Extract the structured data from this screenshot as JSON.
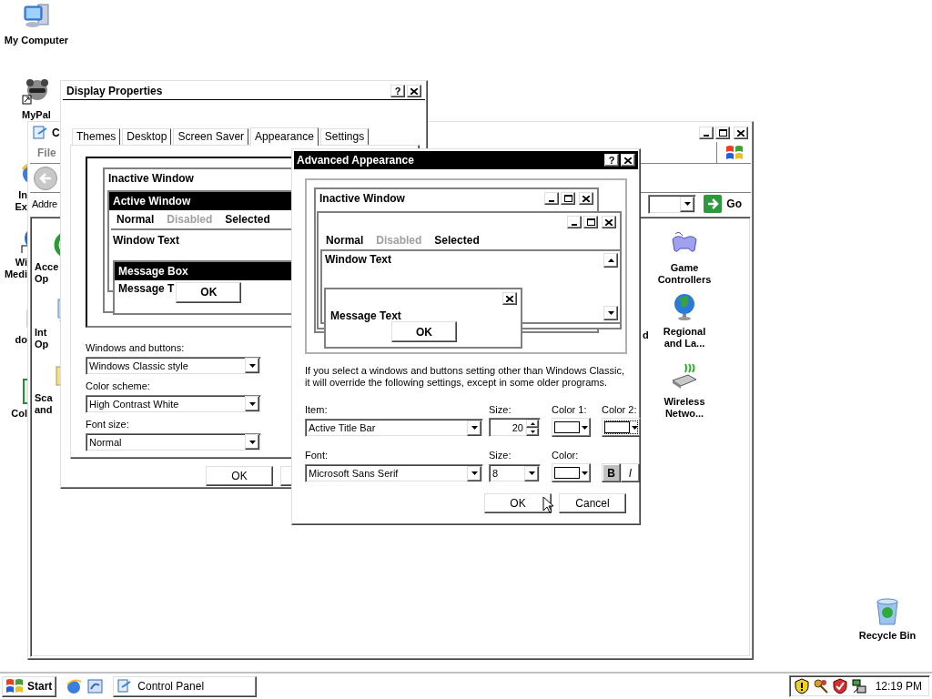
{
  "desktop_icons": [
    {
      "label": "My Computer",
      "kind": "computer"
    },
    {
      "label": "MyPal",
      "kind": "animal"
    },
    {
      "label": "Recycle Bin",
      "kind": "recycle"
    }
  ],
  "desktop_icons_cut": [
    {
      "lines": [
        "In",
        "Ex"
      ],
      "kind": "browser"
    },
    {
      "lines": [
        "Wi",
        "Medi"
      ],
      "kind": "media"
    },
    {
      "lines": [
        "do"
      ],
      "kind": "folder"
    },
    {
      "lines": [
        "Col"
      ],
      "kind": "panel"
    }
  ],
  "control_panel": {
    "title": "C",
    "menu": [
      "File"
    ],
    "address_label": "Addre",
    "go_label": "Go",
    "items": [
      {
        "lines": [
          "Acce",
          "Op"
        ],
        "kind": "accessibility"
      },
      {
        "lines": [
          "Int",
          "Op"
        ],
        "kind": "internet"
      },
      {
        "lines": [
          "Sca",
          "and"
        ],
        "kind": "scanner"
      },
      {
        "lines": [
          "d"
        ],
        "kind": "none"
      },
      {
        "lines": [
          "Game",
          "Controllers"
        ],
        "kind": "gamepad"
      },
      {
        "lines": [
          "Regional",
          "and La..."
        ],
        "kind": "globe"
      },
      {
        "lines": [
          "Wireless",
          "Netwo..."
        ],
        "kind": "wireless"
      }
    ]
  },
  "display_properties": {
    "title": "Display Properties",
    "help": "?",
    "tabs": [
      {
        "label": "Themes",
        "selected": false
      },
      {
        "label": "Desktop",
        "selected": false
      },
      {
        "label": "Screen Saver",
        "selected": false
      },
      {
        "label": "Appearance",
        "selected": true
      },
      {
        "label": "Settings",
        "selected": false
      }
    ],
    "preview": {
      "inactive_title": "Inactive Window",
      "active_title": "Active Window",
      "menu": [
        {
          "label": "Normal",
          "disabled": false
        },
        {
          "label": "Disabled",
          "disabled": true
        },
        {
          "label": "Selected",
          "disabled": false
        }
      ],
      "window_text": "Window Text",
      "message_title": "Message Box",
      "message_text": "Message T",
      "ok": "OK"
    },
    "fields": [
      {
        "label": "Windows and buttons:",
        "value": "Windows Classic style"
      },
      {
        "label": "Color scheme:",
        "value": "High Contrast White"
      },
      {
        "label": "Font size:",
        "value": "Normal"
      }
    ],
    "buttons": [
      "OK"
    ]
  },
  "advanced_appearance": {
    "title": "Advanced Appearance",
    "help": "?",
    "preview": {
      "inactive_title": "Inactive Window",
      "menu": [
        {
          "label": "Normal",
          "disabled": false
        },
        {
          "label": "Disabled",
          "disabled": true
        },
        {
          "label": "Selected",
          "disabled": false
        }
      ],
      "window_text": "Window Text",
      "message_text": "Message Text",
      "ok": "OK"
    },
    "note": "If you select a windows and buttons setting other than Windows Classic,\nit will override the following settings, except in some older programs.",
    "item": {
      "label": "Item:",
      "value": "Active Title Bar"
    },
    "item_size": {
      "label": "Size:",
      "value": "20"
    },
    "color1": {
      "label": "Color 1:"
    },
    "color2": {
      "label": "Color 2:"
    },
    "font": {
      "label": "Font:",
      "value": "Microsoft Sans Serif"
    },
    "font_size": {
      "label": "Size:",
      "value": "8"
    },
    "font_color": {
      "label": "Color:"
    },
    "styles": [
      {
        "label": "B",
        "selected": true
      },
      {
        "label": "I",
        "selected": false
      }
    ],
    "buttons": [
      "OK",
      "Cancel"
    ]
  },
  "taskbar": {
    "start": "Start",
    "tasks": [
      {
        "label": "Control Panel",
        "selected": false
      }
    ],
    "clock": "12:19 PM"
  }
}
